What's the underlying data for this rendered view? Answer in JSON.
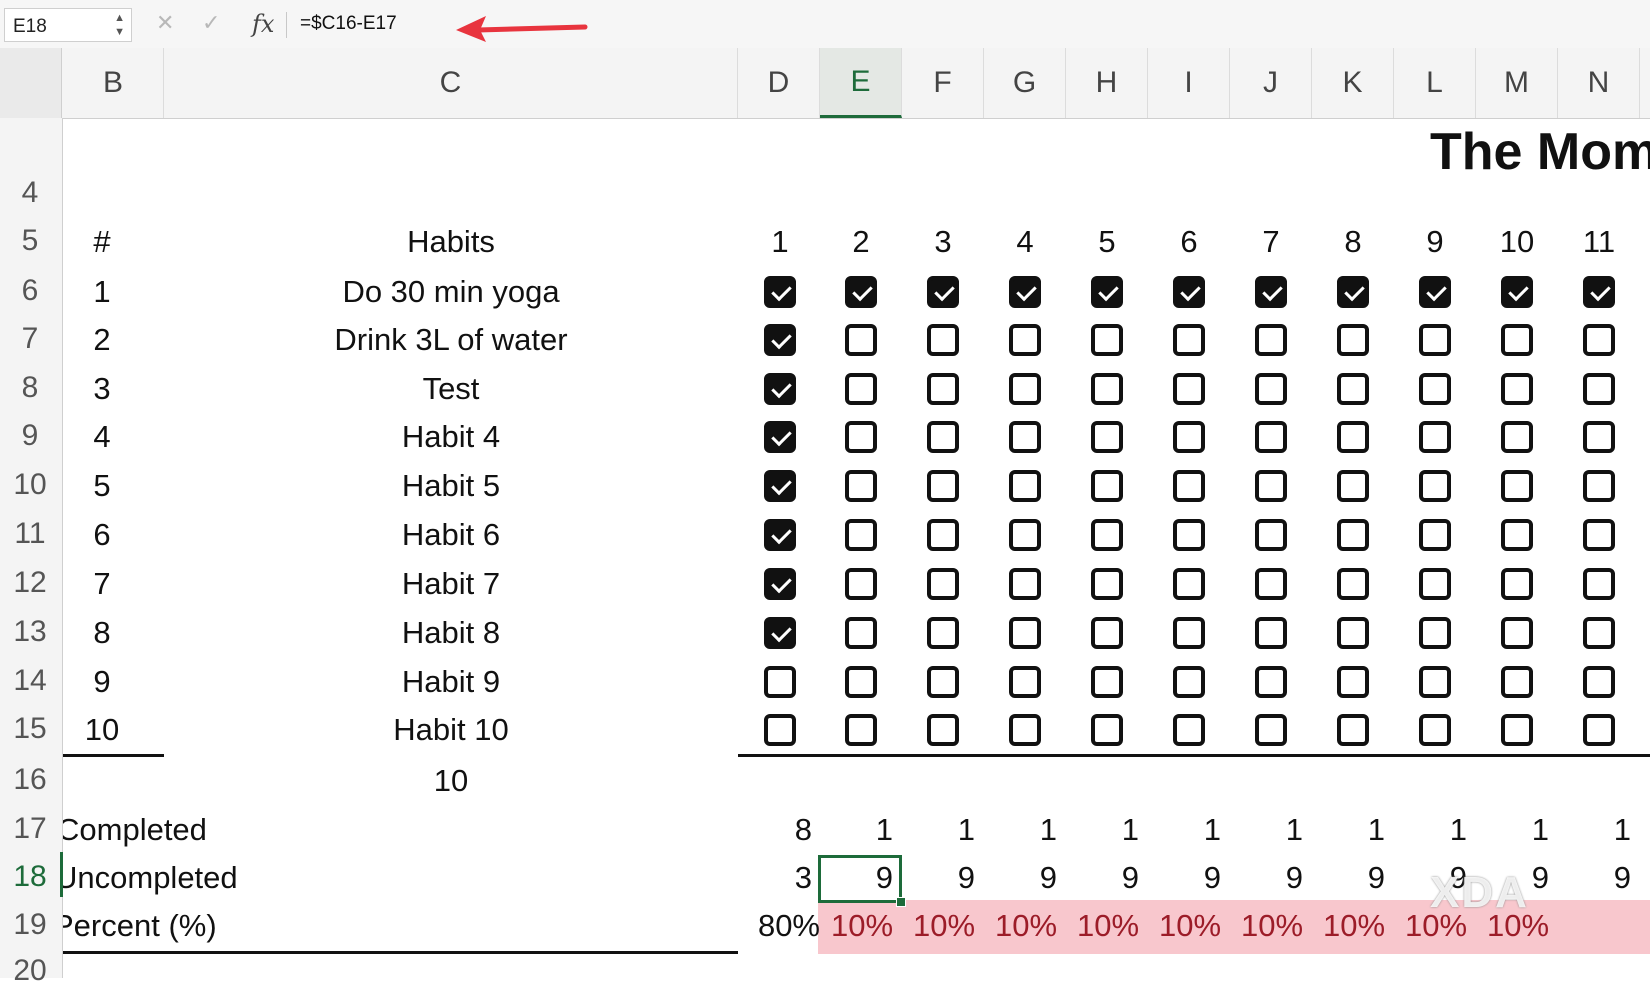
{
  "formula_bar": {
    "name_box": "E18",
    "fx_label": "fx",
    "formula": "=$C16-E17"
  },
  "columns": [
    "B",
    "C",
    "D",
    "E",
    "F",
    "G",
    "H",
    "I",
    "J",
    "K",
    "L",
    "M",
    "N"
  ],
  "active_column": "E",
  "rows": [
    "4",
    "5",
    "6",
    "7",
    "8",
    "9",
    "10",
    "11",
    "12",
    "13",
    "14",
    "15",
    "16",
    "17",
    "18",
    "19",
    "20"
  ],
  "active_row": "18",
  "title": "The Mom",
  "header_row": {
    "num_label": "#",
    "habits_label": "Habits",
    "days": [
      "1",
      "2",
      "3",
      "4",
      "5",
      "6",
      "7",
      "8",
      "9",
      "10",
      "11"
    ]
  },
  "habits": [
    {
      "num": "1",
      "name": "Do 30 min yoga",
      "checks": [
        true,
        true,
        true,
        true,
        true,
        true,
        true,
        true,
        true,
        true,
        true
      ]
    },
    {
      "num": "2",
      "name": "Drink 3L of water",
      "checks": [
        true,
        false,
        false,
        false,
        false,
        false,
        false,
        false,
        false,
        false,
        false
      ]
    },
    {
      "num": "3",
      "name": "Test",
      "checks": [
        true,
        false,
        false,
        false,
        false,
        false,
        false,
        false,
        false,
        false,
        false
      ]
    },
    {
      "num": "4",
      "name": "Habit 4",
      "checks": [
        true,
        false,
        false,
        false,
        false,
        false,
        false,
        false,
        false,
        false,
        false
      ]
    },
    {
      "num": "5",
      "name": "Habit 5",
      "checks": [
        true,
        false,
        false,
        false,
        false,
        false,
        false,
        false,
        false,
        false,
        false
      ]
    },
    {
      "num": "6",
      "name": "Habit 6",
      "checks": [
        true,
        false,
        false,
        false,
        false,
        false,
        false,
        false,
        false,
        false,
        false
      ]
    },
    {
      "num": "7",
      "name": "Habit 7",
      "checks": [
        true,
        false,
        false,
        false,
        false,
        false,
        false,
        false,
        false,
        false,
        false
      ]
    },
    {
      "num": "8",
      "name": "Habit 8",
      "checks": [
        true,
        false,
        false,
        false,
        false,
        false,
        false,
        false,
        false,
        false,
        false
      ]
    },
    {
      "num": "9",
      "name": "Habit 9",
      "checks": [
        false,
        false,
        false,
        false,
        false,
        false,
        false,
        false,
        false,
        false,
        false
      ]
    },
    {
      "num": "10",
      "name": "Habit 10",
      "checks": [
        false,
        false,
        false,
        false,
        false,
        false,
        false,
        false,
        false,
        false,
        false
      ]
    }
  ],
  "total_habits": "10",
  "completed": {
    "label": "Completed",
    "values": [
      "8",
      "1",
      "1",
      "1",
      "1",
      "1",
      "1",
      "1",
      "1",
      "1",
      "1"
    ]
  },
  "uncompleted": {
    "label": "Uncompleted",
    "values": [
      "3",
      "9",
      "9",
      "9",
      "9",
      "9",
      "9",
      "9",
      "9",
      "9",
      "9"
    ]
  },
  "percent": {
    "label": "Percent (%)",
    "values": [
      "80%",
      "10%",
      "10%",
      "10%",
      "10%",
      "10%",
      "10%",
      "10%",
      "10%",
      "10%"
    ]
  },
  "watermark": "XDA",
  "colors": {
    "selection": "#1d6b3a",
    "low_percent_fill": "#f8c7cd",
    "low_percent_text": "#9c1c28",
    "arrow": "#e8343e"
  }
}
